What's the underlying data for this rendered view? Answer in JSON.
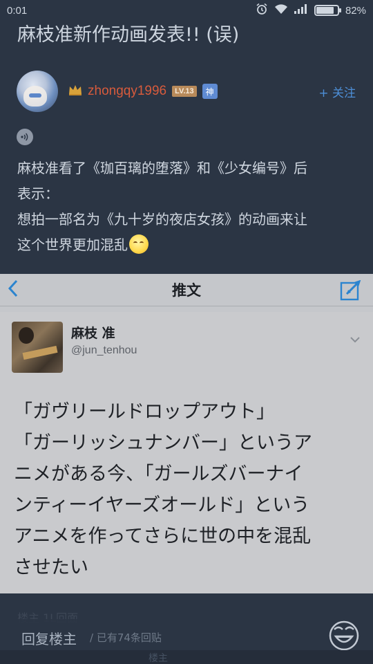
{
  "status_bar": {
    "time": "0:01",
    "battery_text": "82%",
    "battery_level": 0.82,
    "icons": [
      "alarm-icon",
      "wifi-icon",
      "signal-icon",
      "battery-icon"
    ]
  },
  "post": {
    "title": "麻枝准新作动画发表!! (误)",
    "author": {
      "username": "zhongqy1996",
      "level_badge": "LV.13",
      "god_badge": "神",
      "follow_label": "+ 关注"
    },
    "body_lines": [
      "麻枝准看了《珈百璃的堕落》和《少女编号》后",
      "表示：",
      "想拍一部名为《九十岁的夜店女孩》的动画来让",
      "这个世界更加混乱"
    ]
  },
  "tweet_screenshot": {
    "nav_title": "推文",
    "author_name": "麻枝 准",
    "author_handle": "@jun_tenhou",
    "text_lines": [
      "「ガヴリールドロップアウト」",
      "「ガーリッシュナンバー」というア",
      "ニメがある今、「ガールズバーナイ",
      "ンティーイヤーズオールド」という",
      "アニメを作ってさらに世の中を混乱",
      "させたい"
    ]
  },
  "footer": {
    "floor_info": "楼主   1L回面",
    "reply_label": "回复楼主",
    "reply_count": "/ 已有74条回贴",
    "strip_text": "楼主"
  },
  "colors": {
    "background": "#2b3544",
    "username": "#d85b3c",
    "accent_blue": "#4d8fd8",
    "tweet_bg": "#c9cacd"
  }
}
